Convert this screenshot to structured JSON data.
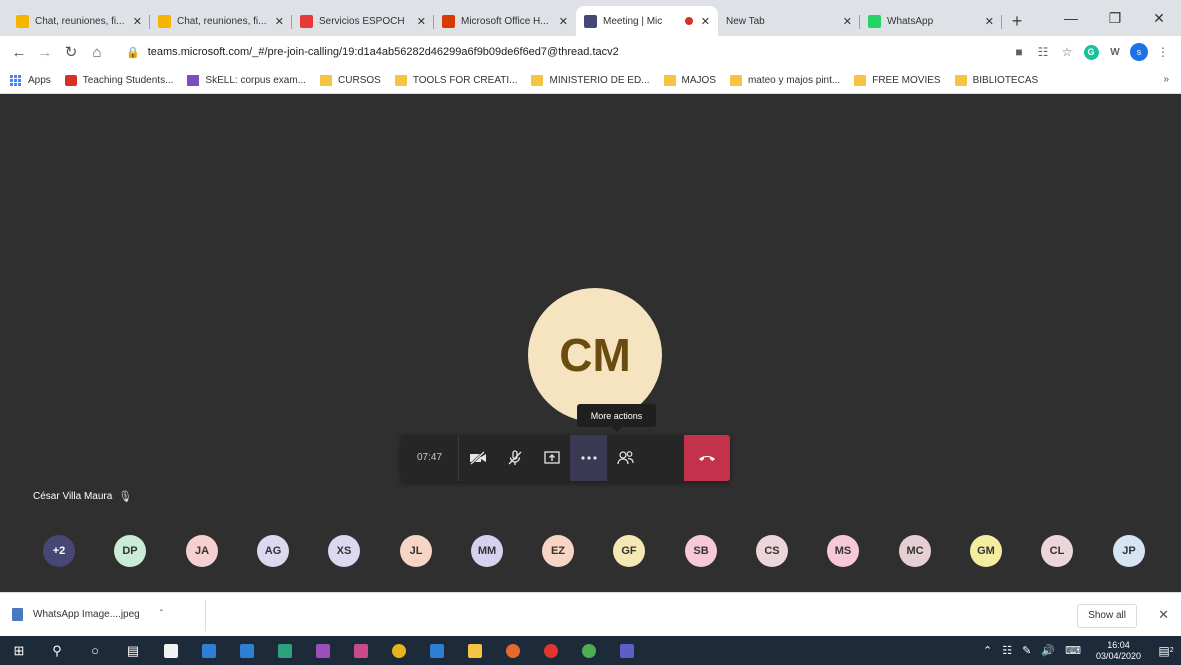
{
  "browser": {
    "tabs": [
      {
        "title": "Chat, reuniones, fi...",
        "favicon": "teams-grid-icon",
        "color": "#f4b400"
      },
      {
        "title": "Chat, reuniones, fi...",
        "favicon": "teams-grid-icon",
        "color": "#f4b400"
      },
      {
        "title": "Servicios ESPOCH",
        "favicon": "espoch-star-icon",
        "color": "#e53935"
      },
      {
        "title": "Microsoft Office H...",
        "favicon": "office-icon",
        "color": "#d83b01"
      },
      {
        "title": "Meeting | Mic",
        "favicon": "teams-icon",
        "color": "#464775",
        "recording": true
      },
      {
        "title": "New Tab",
        "favicon": "",
        "color": ""
      },
      {
        "title": "WhatsApp",
        "favicon": "whatsapp-icon",
        "color": "#25d366"
      }
    ],
    "active_tab": 4,
    "new_tab_symbol": "+",
    "url": "teams.microsoft.com/_#/pre-join-calling/19:d1a4ab56282d46299a6f9b09de6f6ed7@thread.tacv2",
    "bookmarks": [
      {
        "label": "Apps",
        "type": "apps"
      },
      {
        "label": "Teaching Students...",
        "type": "tch"
      },
      {
        "label": "SkELL: corpus exam...",
        "type": "skell"
      },
      {
        "label": "CURSOS",
        "type": "folder"
      },
      {
        "label": "TOOLS FOR CREATI...",
        "type": "folder"
      },
      {
        "label": "MINISTERIO DE ED...",
        "type": "folder"
      },
      {
        "label": "MAJOS",
        "type": "folder"
      },
      {
        "label": "mateo y majos pint...",
        "type": "folder"
      },
      {
        "label": "FREE MOVIES",
        "type": "folder"
      },
      {
        "label": "BIBLIOTECAS",
        "type": "folder"
      }
    ],
    "bookmarks_more": "»",
    "extensions": {
      "grammarly": "G",
      "w": "W",
      "profile": "s"
    }
  },
  "meeting": {
    "main_initials": "CM",
    "tooltip": "More actions",
    "timer": "07:47",
    "self_name": "César Villa Maura",
    "participants": [
      {
        "initials": "+2",
        "color": "#464775",
        "more": true
      },
      {
        "initials": "DP",
        "color": "#c9ecd6"
      },
      {
        "initials": "JA",
        "color": "#f6d0d0"
      },
      {
        "initials": "AG",
        "color": "#dcd8f0"
      },
      {
        "initials": "XS",
        "color": "#dcd8f0"
      },
      {
        "initials": "JL",
        "color": "#f7d5c5"
      },
      {
        "initials": "MM",
        "color": "#d4d2ee"
      },
      {
        "initials": "EZ",
        "color": "#f7d5c5"
      },
      {
        "initials": "GF",
        "color": "#f6e8b3"
      },
      {
        "initials": "SB",
        "color": "#f7c9d6"
      },
      {
        "initials": "CS",
        "color": "#ecd6da"
      },
      {
        "initials": "MS",
        "color": "#f7c9d6"
      },
      {
        "initials": "MC",
        "color": "#e6cfd3"
      },
      {
        "initials": "GM",
        "color": "#f3ee9f"
      },
      {
        "initials": "CL",
        "color": "#ecd6da"
      },
      {
        "initials": "JP",
        "color": "#d6e4f3"
      }
    ]
  },
  "downloads": {
    "file": "WhatsApp Image....jpeg",
    "show_all": "Show all"
  },
  "taskbar": {
    "time": "16:04",
    "date": "03/04/2020",
    "notifications": "2"
  }
}
